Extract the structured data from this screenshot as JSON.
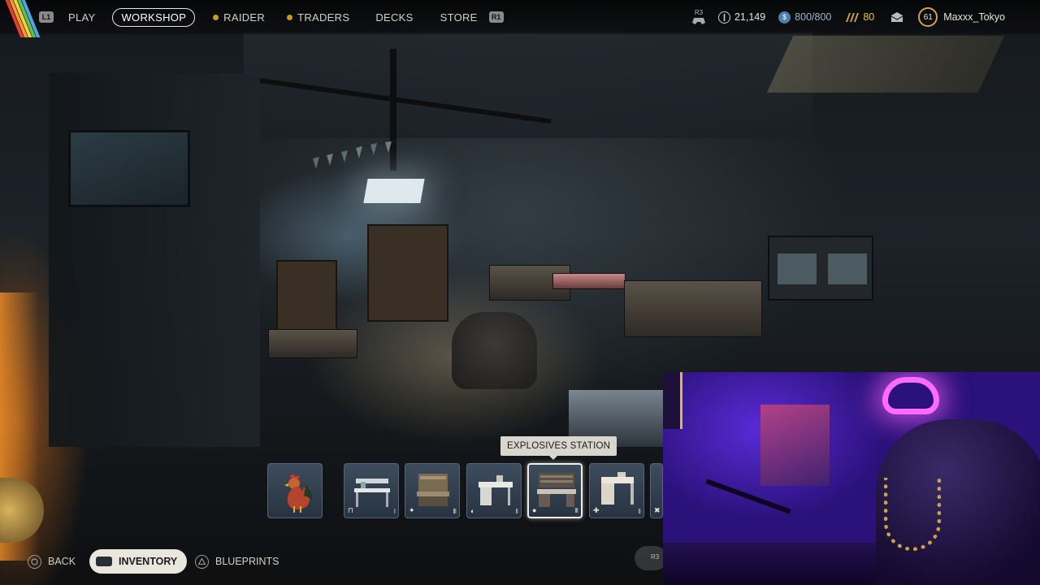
{
  "nav": {
    "left_hint": "L1",
    "right_hint": "R1",
    "items": [
      {
        "label": "PLAY",
        "active": false,
        "dot": false
      },
      {
        "label": "WORKSHOP",
        "active": true,
        "dot": false
      },
      {
        "label": "RAIDER",
        "active": false,
        "dot": true
      },
      {
        "label": "TRADERS",
        "active": false,
        "dot": true
      },
      {
        "label": "DECKS",
        "active": false,
        "dot": false
      },
      {
        "label": "STORE",
        "active": false,
        "dot": false
      }
    ]
  },
  "status": {
    "r3_hint": "R3",
    "coins": "21,149",
    "capacity": "800/800",
    "tokens": "80",
    "level": "61",
    "username": "Maxxx_Tokyo"
  },
  "tooltip": "EXPLOSIVES STATION",
  "stations": [
    {
      "icon": "rooster-icon",
      "badge": "",
      "tier": ""
    },
    {
      "icon": "workbench-icon",
      "badge": "⊓",
      "tier": "I"
    },
    {
      "icon": "gunsmith-icon",
      "badge": "✦",
      "tier": "III"
    },
    {
      "icon": "gear-bench-icon",
      "badge": "◐",
      "tier": "II"
    },
    {
      "icon": "explosives-station-icon",
      "badge": "●",
      "tier": "III"
    },
    {
      "icon": "medical-lab-icon",
      "badge": "✚",
      "tier": "II"
    },
    {
      "icon": "refiner-icon",
      "badge": "✖",
      "tier": ""
    }
  ],
  "bottom": {
    "back": "BACK",
    "inventory": "INVENTORY",
    "blueprints": "BLUEPRINTS",
    "r3_hint": "R3"
  },
  "colors": {
    "accent_gold": "#d2a24a",
    "slot_bg": "#2f3d4c",
    "active_pill": "#e9e6de"
  }
}
